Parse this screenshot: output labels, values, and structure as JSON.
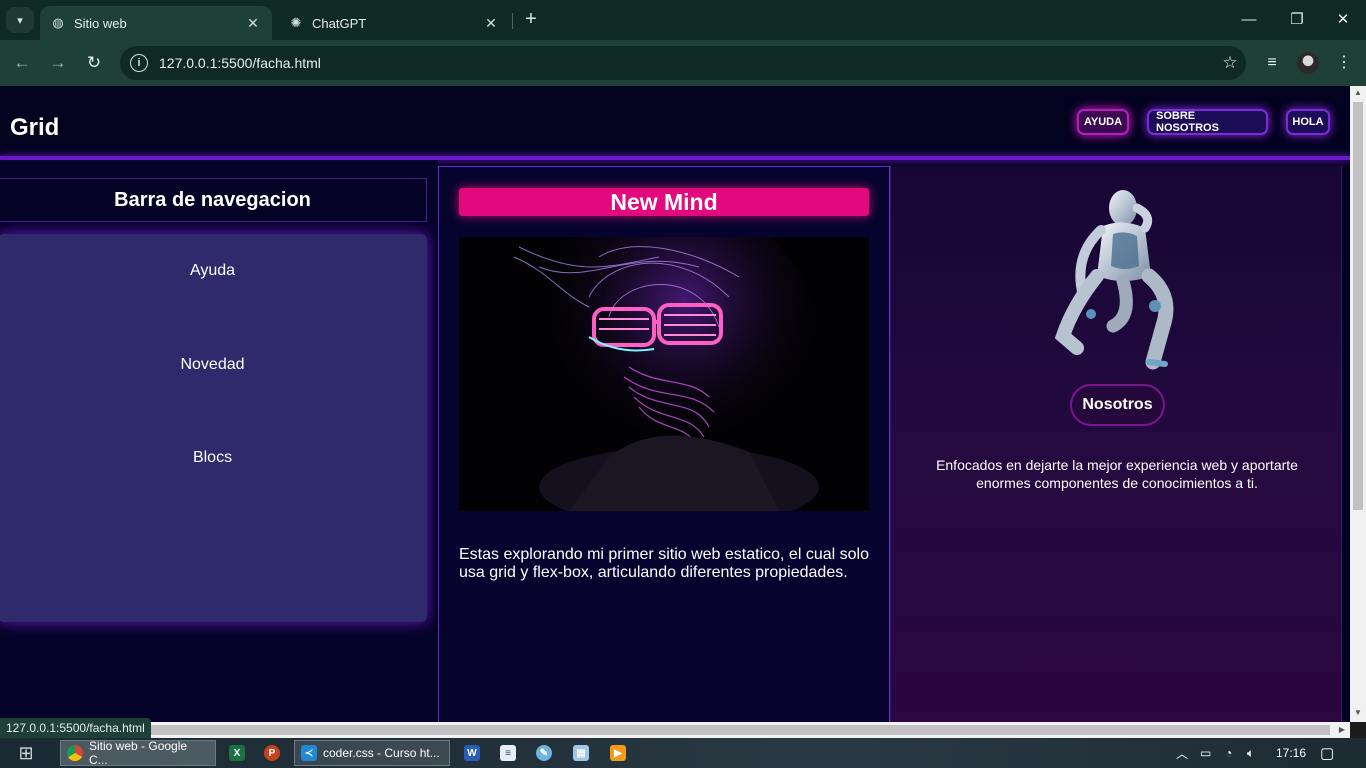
{
  "browser": {
    "tabs": [
      {
        "title": "Sitio web",
        "active": true
      },
      {
        "title": "ChatGPT",
        "active": false
      }
    ],
    "url": "127.0.0.1:5500/facha.html",
    "status_url": "127.0.0.1:5500/facha.html"
  },
  "site": {
    "brand": "Grid",
    "header_links": [
      "AYUDA",
      "SOBRE NOSOTROS",
      "HOLA"
    ],
    "sidebar": {
      "title": "Barra de navegacion",
      "items": [
        "Ayuda",
        "Novedad",
        "Blocs"
      ]
    },
    "main": {
      "title": "New Mind",
      "text": "Estas explorando mi primer sitio web estatico, el cual solo usa grid y flex-box, articulando diferentes propiedades."
    },
    "aside": {
      "button": "Nosotros",
      "text": "Enfocados en dejarte la mejor experiencia web y aportarte enormes componentes de conocimientos a ti."
    }
  },
  "taskbar": {
    "tasks": [
      {
        "label": "Sitio web - Google C...",
        "icon": "chrome-icon"
      },
      {
        "label": "coder.css - Curso ht...",
        "icon": "vscode-icon"
      }
    ],
    "time": "17:16"
  },
  "colors": {
    "page_bg": "#03021f",
    "accent_pink": "#e2097f",
    "accent_purple": "#6a16c9",
    "chrome_tab": "#1e4036"
  }
}
